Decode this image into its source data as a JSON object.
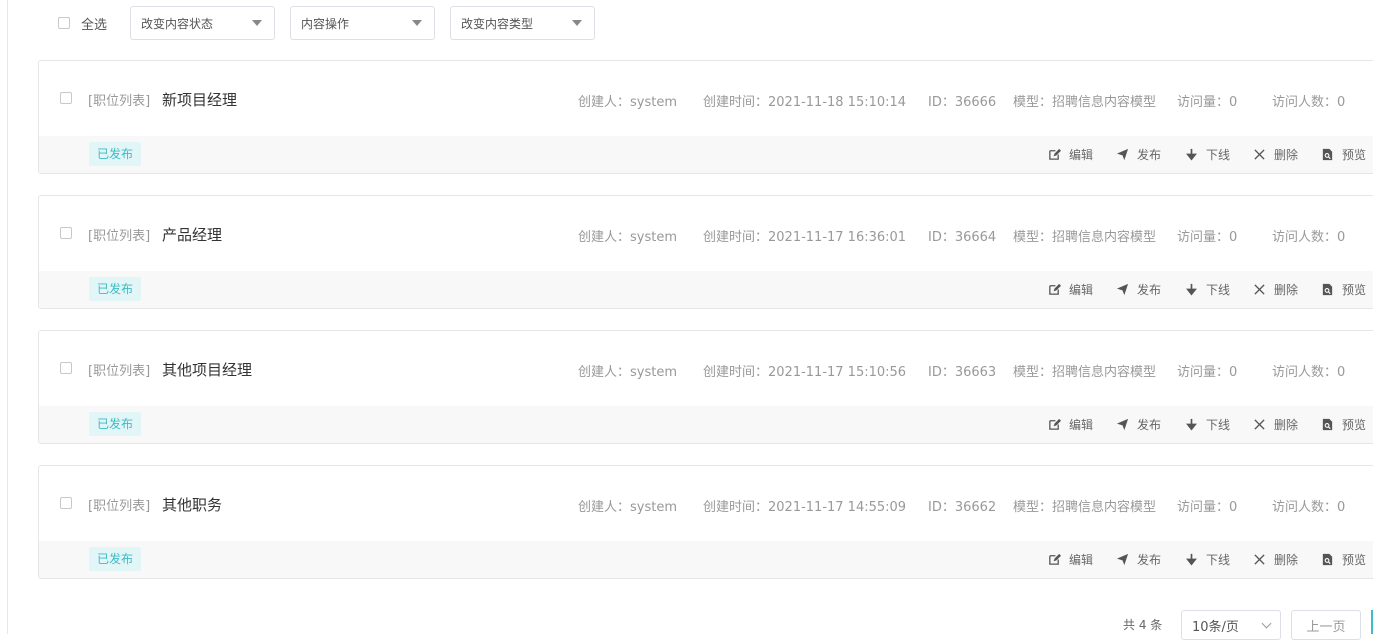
{
  "toolbar": {
    "select_all_label": "全选",
    "dropdowns": [
      {
        "label": "改变内容状态"
      },
      {
        "label": "内容操作"
      },
      {
        "label": "改变内容类型"
      }
    ]
  },
  "items": [
    {
      "category": "[职位列表]",
      "title": "新项目经理",
      "creator": "创建人：system",
      "created": "创建时间：2021-11-18 15:10:14",
      "id": "ID：36666",
      "model": "模型：招聘信息内容模型",
      "views": "访问量：0",
      "visitors": "访问人数：0",
      "status": "已发布"
    },
    {
      "category": "[职位列表]",
      "title": "产品经理",
      "creator": "创建人：system",
      "created": "创建时间：2021-11-17 16:36:01",
      "id": "ID：36664",
      "model": "模型：招聘信息内容模型",
      "views": "访问量：0",
      "visitors": "访问人数：0",
      "status": "已发布"
    },
    {
      "category": "[职位列表]",
      "title": "其他项目经理",
      "creator": "创建人：system",
      "created": "创建时间：2021-11-17 15:10:56",
      "id": "ID：36663",
      "model": "模型：招聘信息内容模型",
      "views": "访问量：0",
      "visitors": "访问人数：0",
      "status": "已发布"
    },
    {
      "category": "[职位列表]",
      "title": "其他职务",
      "creator": "创建人：system",
      "created": "创建时间：2021-11-17 14:55:09",
      "id": "ID：36662",
      "model": "模型：招聘信息内容模型",
      "views": "访问量：0",
      "visitors": "访问人数：0",
      "status": "已发布"
    }
  ],
  "actions": {
    "edit": "编辑",
    "publish": "发布",
    "offline": "下线",
    "delete": "删除",
    "preview": "预览"
  },
  "icons": {
    "edit": "edit-icon",
    "publish": "send-icon",
    "offline": "arrow-down-icon",
    "delete": "close-icon",
    "preview": "file-preview-icon"
  },
  "colors": {
    "status_badge_text": "#3dbcc6",
    "status_badge_bg": "#e2f5f7"
  },
  "pagination": {
    "total": "共 4 条",
    "page_size": "10条/页",
    "prev": "上一页"
  }
}
